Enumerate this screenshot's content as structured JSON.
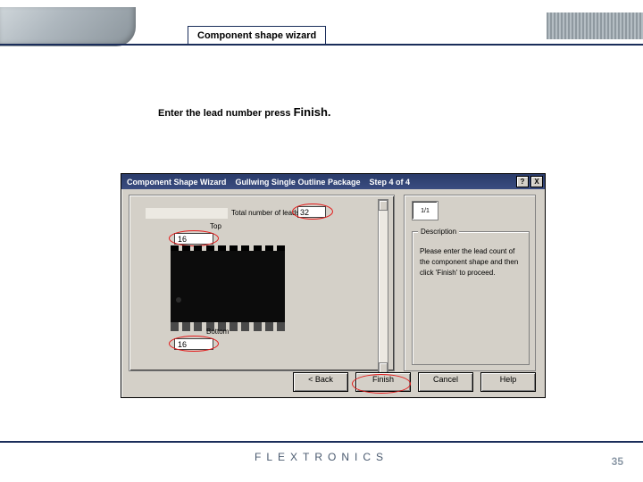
{
  "slide": {
    "title_tab": "Component shape wizard",
    "instruction_pre": "Enter the lead number press ",
    "instruction_action": "Finish.",
    "brand": "FLEXTRONICS",
    "page_number": "35"
  },
  "dialog": {
    "title_a": "Component Shape Wizard",
    "title_b": "Gullwing Single Outline Package",
    "title_c": "Step 4 of 4",
    "winbtn_help": "?",
    "winbtn_close": "X",
    "preview_hint": "1/1",
    "total_leads_label": "Total number of leads",
    "total_leads_value": "32",
    "top_label": "Top",
    "top_value": "16",
    "bottom_label": "Bottom",
    "bottom_value": "16",
    "description_label": "Description",
    "description_text": "Please enter the lead count of the component shape and then click 'Finish' to proceed.",
    "buttons": {
      "back": "< Back",
      "finish": "Finish",
      "cancel": "Cancel",
      "help": "Help"
    }
  }
}
